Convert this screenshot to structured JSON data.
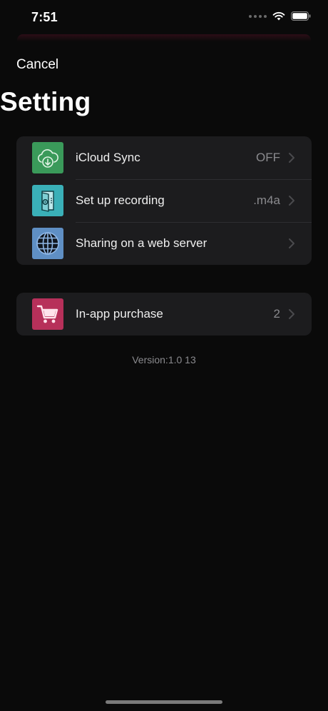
{
  "status_bar": {
    "time": "7:51"
  },
  "header": {
    "cancel_label": "Cancel",
    "title": "Setting"
  },
  "settings_group": {
    "items": [
      {
        "label": "iCloud Sync",
        "value": "OFF",
        "icon": "cloud-sync-icon",
        "icon_color": "#3a9a5a"
      },
      {
        "label": "Set up recording",
        "value": ".m4a",
        "icon": "recorder-icon",
        "icon_color": "#3ab0b8"
      },
      {
        "label": "Sharing on a web server",
        "value": "",
        "icon": "globe-icon",
        "icon_color": "#5f8fc4"
      }
    ]
  },
  "purchase_group": {
    "items": [
      {
        "label": "In-app purchase",
        "value": "2",
        "icon": "cart-icon",
        "icon_color": "#b7305a"
      }
    ]
  },
  "version": "Version:1.0 13",
  "colors": {
    "background": "#0a0a0a",
    "cell_background": "#1c1c1e",
    "secondary_text": "#8a8a8e"
  }
}
